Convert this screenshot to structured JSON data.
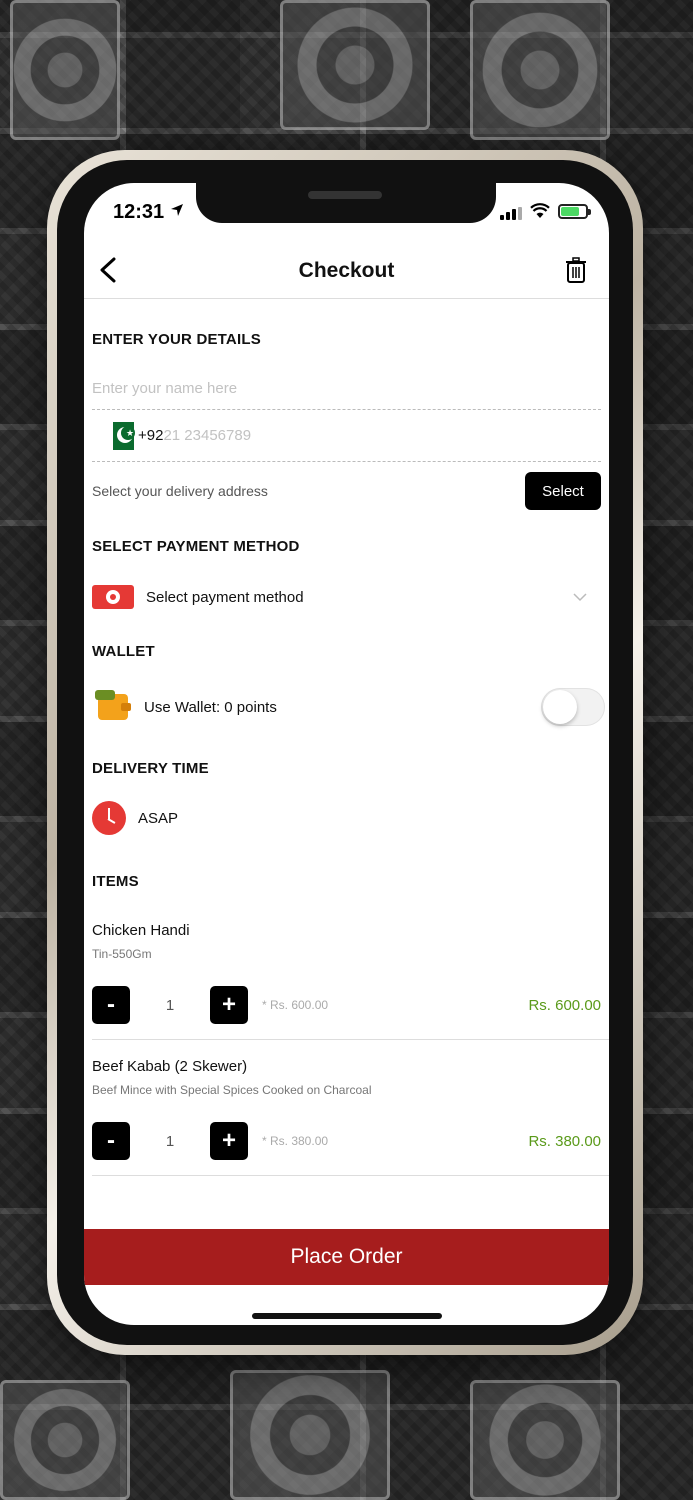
{
  "status": {
    "time": "12:31"
  },
  "nav": {
    "title": "Checkout"
  },
  "details": {
    "heading": "ENTER YOUR DETAILS",
    "name_placeholder": "Enter your name here",
    "country_code": "+92",
    "phone_placeholder": "21 23456789",
    "address_label": "Select your delivery address",
    "select_button": "Select"
  },
  "payment": {
    "heading": "SELECT PAYMENT METHOD",
    "selected_label": "Select payment method",
    "icon": "cash-icon"
  },
  "wallet": {
    "heading": "WALLET",
    "label": "Use Wallet: 0 points",
    "enabled": false
  },
  "delivery": {
    "heading": "DELIVERY TIME",
    "value": "ASAP"
  },
  "items": {
    "heading": "ITEMS",
    "list": [
      {
        "name": "Chicken Handi",
        "desc": "Tin-550Gm",
        "qty": "1",
        "unit_price": "* Rs. 600.00",
        "total": "Rs. 600.00"
      },
      {
        "name": "Beef Kabab (2 Skewer)",
        "desc": "Beef Mince with Special Spices Cooked on Charcoal",
        "qty": "1",
        "unit_price": "* Rs. 380.00",
        "total": "Rs. 380.00"
      }
    ],
    "minus_label": "-",
    "plus_label": "+"
  },
  "place_order": {
    "label": "Place Order"
  },
  "colors": {
    "accent": "#a61d1d",
    "price_green": "#5a9a1a"
  }
}
